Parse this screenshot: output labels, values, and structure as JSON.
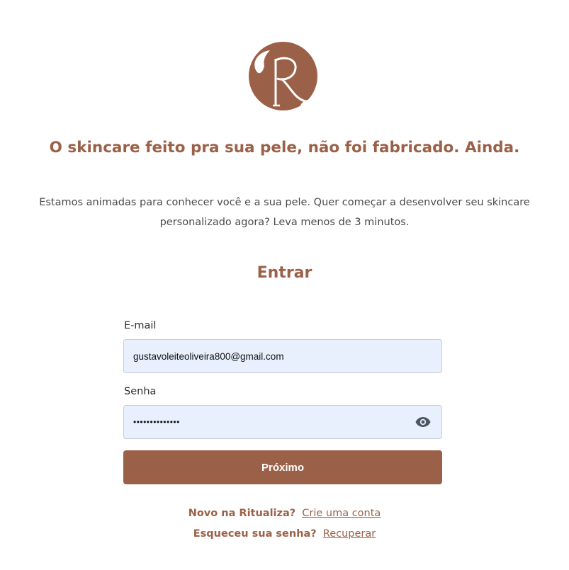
{
  "brand": {
    "logo_letter": "R",
    "accent_color": "#9b6148"
  },
  "hero": {
    "headline": "O skincare feito pra sua pele, não foi fabricado. Ainda.",
    "intro": "Estamos animadas para conhecer você e a sua pele. Quer começar a desenvolver seu skincare personalizado agora? Leva menos de 3 minutos."
  },
  "login": {
    "title": "Entrar",
    "email_label": "E-mail",
    "email_value": "gustavoleiteoliveira800@gmail.com",
    "password_label": "Senha",
    "password_value": "••••••••••••••",
    "toggle_icon": "eye-icon",
    "submit_label": "Próximo"
  },
  "links": {
    "signup_prompt": "Novo na Ritualiza?",
    "signup_link": "Crie uma conta",
    "recover_prompt": "Esqueceu sua senha?",
    "recover_link": "Recuperar"
  }
}
